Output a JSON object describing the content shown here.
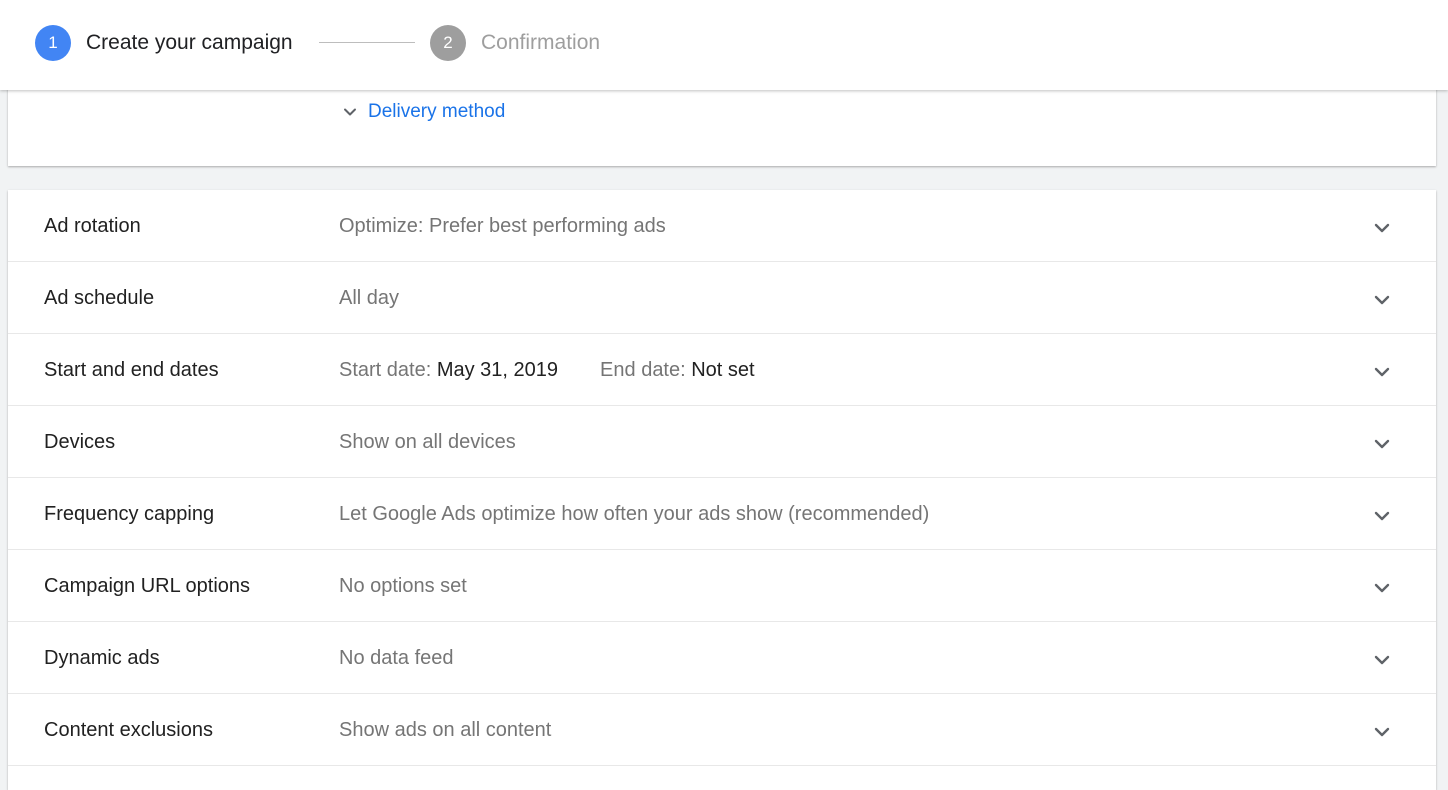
{
  "stepper": {
    "steps": [
      {
        "number": "1",
        "label": "Create your campaign",
        "state": "active",
        "color": "#4285f4"
      },
      {
        "number": "2",
        "label": "Confirmation",
        "state": "inactive",
        "color": "#9e9e9e"
      }
    ]
  },
  "delivery": {
    "label": "Delivery method",
    "icon": "chevron-down-icon",
    "color": "#1a73e8"
  },
  "settings": [
    {
      "title": "Ad rotation",
      "value": "Optimize: Prefer best performing ads"
    },
    {
      "title": "Ad schedule",
      "value": "All day"
    },
    {
      "title": "Start and end dates",
      "start_label": "Start date:",
      "start_value": "May 31, 2019",
      "end_label": "End date:",
      "end_value": "Not set"
    },
    {
      "title": "Devices",
      "value": "Show on all devices"
    },
    {
      "title": "Frequency capping",
      "value": "Let Google Ads optimize how often your ads show (recommended)"
    },
    {
      "title": "Campaign URL options",
      "value": "No options set"
    },
    {
      "title": "Dynamic ads",
      "value": "No data feed"
    },
    {
      "title": "Content exclusions",
      "value": "Show ads on all content"
    }
  ]
}
